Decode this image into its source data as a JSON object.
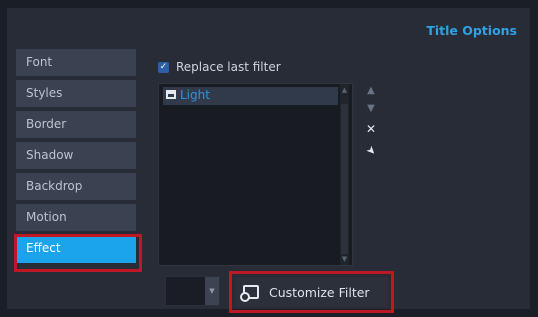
{
  "header": {
    "title": "Title Options"
  },
  "tabs": [
    {
      "label": "Font",
      "active": false
    },
    {
      "label": "Styles",
      "active": false
    },
    {
      "label": "Border",
      "active": false
    },
    {
      "label": "Shadow",
      "active": false
    },
    {
      "label": "Backdrop",
      "active": false
    },
    {
      "label": "Motion",
      "active": false
    },
    {
      "label": "Effect",
      "active": true
    }
  ],
  "replace_filter": {
    "label": "Replace last filter",
    "checked": true
  },
  "filter_list": {
    "items": [
      {
        "label": "Light",
        "selected": true,
        "icon": "filter-icon"
      }
    ]
  },
  "side_buttons": {
    "move_up": {
      "icon": "arrow-up-icon",
      "glyph": "▲"
    },
    "move_down": {
      "icon": "arrow-down-icon",
      "glyph": "▼"
    },
    "remove": {
      "icon": "close-icon",
      "glyph": "✕"
    },
    "apply": {
      "icon": "pin-icon",
      "glyph": "➤"
    }
  },
  "customize_button": {
    "label": "Customize Filter",
    "icon": "customize-filter-icon"
  },
  "colors": {
    "accent": "#1ba3ec",
    "title": "#2fa2e6",
    "highlight": "#c01725",
    "panel": "#272c37",
    "tab": "#3a4252"
  }
}
